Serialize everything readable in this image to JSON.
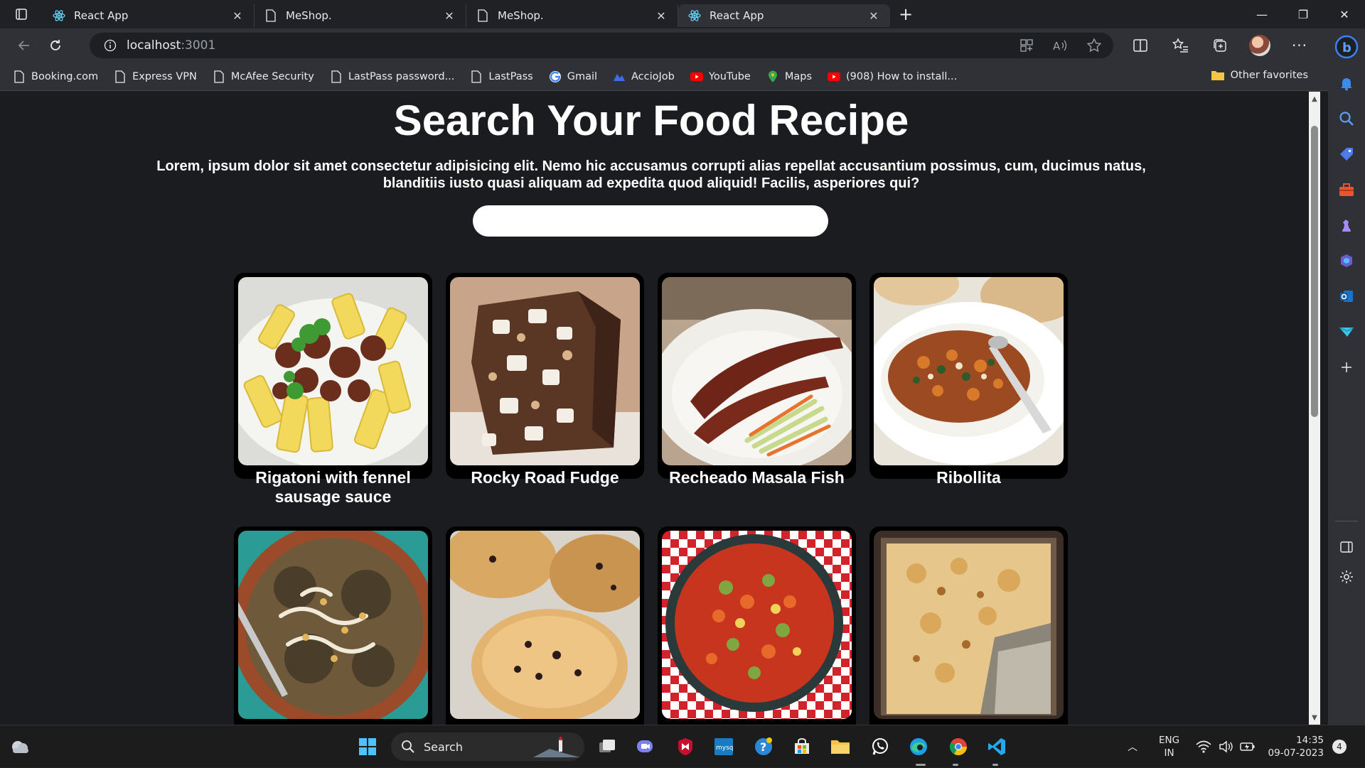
{
  "browser": {
    "tabs": [
      {
        "title": "React App",
        "icon": "react-icon",
        "active": false
      },
      {
        "title": "MeShop.",
        "icon": "page-icon",
        "active": false
      },
      {
        "title": "MeShop.",
        "icon": "page-icon",
        "active": false
      },
      {
        "title": "React App",
        "icon": "react-icon",
        "active": true
      }
    ],
    "new_tab_symbol": "+",
    "url_host": "localhost",
    "url_port": ":3001",
    "bookmarks": [
      {
        "label": "Booking.com",
        "icon": "page-icon"
      },
      {
        "label": "Express VPN",
        "icon": "page-icon"
      },
      {
        "label": "McAfee Security",
        "icon": "page-icon"
      },
      {
        "label": "LastPass password...",
        "icon": "page-icon"
      },
      {
        "label": "LastPass",
        "icon": "page-icon"
      },
      {
        "label": "Gmail",
        "icon": "google-icon"
      },
      {
        "label": "AccioJob",
        "icon": "acciojob-icon"
      },
      {
        "label": "YouTube",
        "icon": "youtube-icon"
      },
      {
        "label": "Maps",
        "icon": "maps-icon"
      },
      {
        "label": "(908) How to install...",
        "icon": "youtube-icon"
      }
    ],
    "other_favorites": "Other favorites"
  },
  "page": {
    "title": "Search Your Food Recipe",
    "intro_line1": "Lorem, ipsum dolor sit amet consectetur adipisicing elit. Nemo hic accusamus corrupti alias repellat accusantium possimus, cum, ducimus natus,",
    "intro_line2": "blanditiis iusto quasi aliquam ad expedita quod aliquid! Facilis, asperiores qui?",
    "search_value": "",
    "recipes": [
      {
        "name": "Rigatoni with fennel sausage sauce"
      },
      {
        "name": "Rocky Road Fudge"
      },
      {
        "name": "Recheado Masala Fish"
      },
      {
        "name": "Ribollita"
      },
      {
        "name": ""
      },
      {
        "name": ""
      },
      {
        "name": ""
      },
      {
        "name": ""
      }
    ]
  },
  "taskbar": {
    "search_label": "Search",
    "lang_top": "ENG",
    "lang_bottom": "IN",
    "time": "14:35",
    "date": "09-07-2023",
    "notification_count": "4"
  }
}
